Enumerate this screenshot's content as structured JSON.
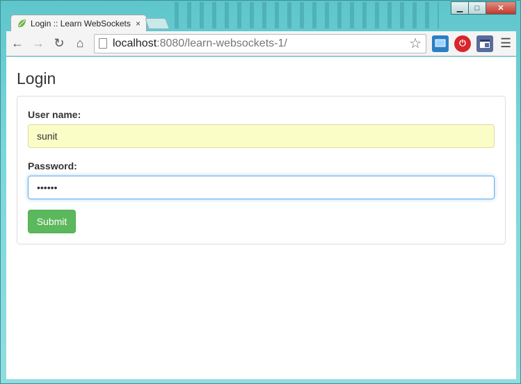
{
  "window": {
    "minimize_icon": "minimize-icon",
    "maximize_icon": "maximize-icon",
    "close_icon": "close-icon"
  },
  "tab": {
    "title": "Login :: Learn WebSockets",
    "close_glyph": "×",
    "icon": "spring-leaf-icon"
  },
  "toolbar": {
    "url_host": "localhost",
    "url_rest": ":8080/learn-websockets-1/"
  },
  "page": {
    "title": "Login",
    "form": {
      "username_label": "User name:",
      "username_value": "sunit",
      "password_label": "Password:",
      "password_value": "••••••",
      "submit_label": "Submit"
    }
  },
  "colors": {
    "submit_bg": "#5cb85c",
    "autofill_bg": "#fbfdc6",
    "focus_border": "#66afe9"
  }
}
